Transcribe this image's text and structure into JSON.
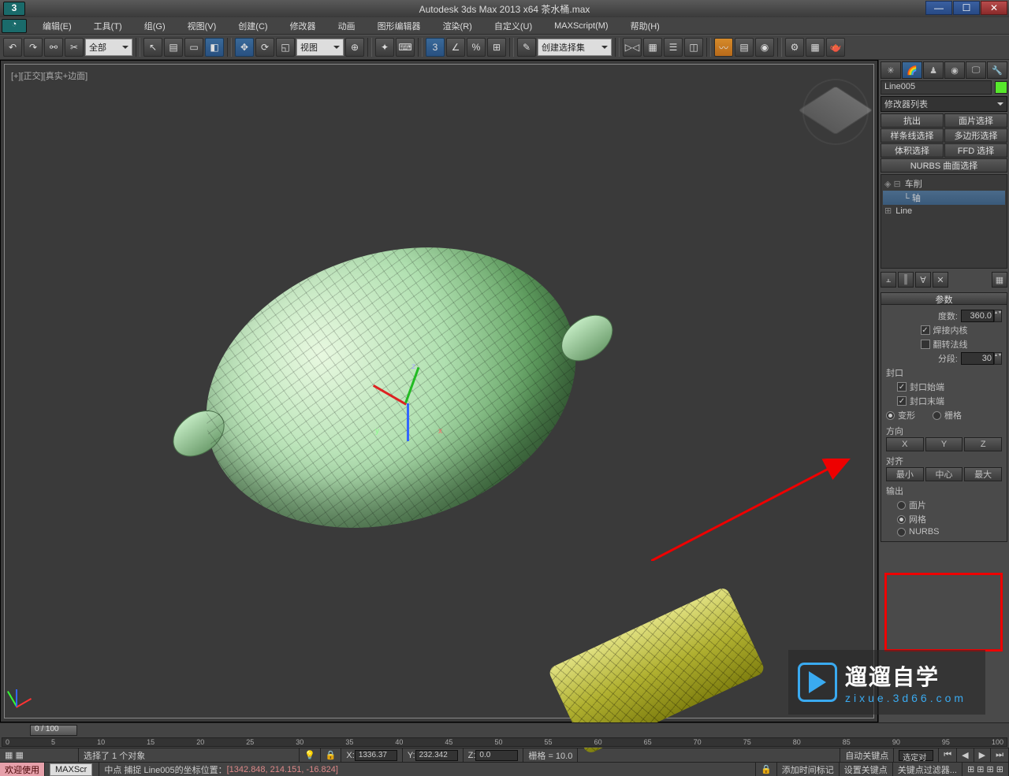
{
  "window": {
    "app_title": "Autodesk 3ds Max  2013 x64     茶水桶.max",
    "min": "—",
    "max": "☐",
    "close": "✕"
  },
  "menubar": {
    "items": [
      "编辑(E)",
      "工具(T)",
      "组(G)",
      "视图(V)",
      "创建(C)",
      "修改器",
      "动画",
      "图形编辑器",
      "渲染(R)",
      "自定义(U)",
      "MAXScript(M)",
      "帮助(H)"
    ]
  },
  "toolbar": {
    "filter_dropdown": "全部",
    "view_dropdown": "视图",
    "nameset_dropdown": "创建选择集"
  },
  "viewport": {
    "label_full": "[+][正交][真实+边面]"
  },
  "commandpanel": {
    "object_name": "Line005",
    "modifier_list": "修改器列表",
    "selectbuttons": [
      "抗出",
      "面片选择",
      "样条线选择",
      "多边形选择",
      "体积选择",
      "FFD 选择"
    ],
    "nurbs_row": "NURBS  曲面选择",
    "stack": {
      "item1": "车削",
      "item1_sub": "轴",
      "item2": "Line"
    },
    "params_title": "参数",
    "degrees_label": "度数:",
    "degrees_value": "360.0",
    "weld_label": "焊接内核",
    "weld_checked": true,
    "flip_label": "翻转法线",
    "flip_checked": false,
    "segments_label": "分段:",
    "segments_value": "30",
    "cap_title": "封口",
    "cap_start": "封口始端",
    "cap_end": "封口末端",
    "morph_label": "变形",
    "grid_label": "栅格",
    "direction_title": "方向",
    "dir_x": "X",
    "dir_y": "Y",
    "dir_z": "Z",
    "align_title": "对齐",
    "align_min": "最小",
    "align_center": "中心",
    "align_max": "最大",
    "output_title": "输出",
    "out_patch": "面片",
    "out_mesh": "网格",
    "out_nurbs": "NURBS"
  },
  "timeline": {
    "frame_label": "0 / 100",
    "ticks": [
      "0",
      "5",
      "10",
      "15",
      "20",
      "25",
      "30",
      "35",
      "40",
      "45",
      "50",
      "55",
      "60",
      "65",
      "70",
      "75",
      "80",
      "85",
      "90",
      "95",
      "100"
    ]
  },
  "status1": {
    "sel_text": "选择了 1 个对象",
    "x_label": "X:",
    "x_val": "1336.37",
    "y_label": "Y:",
    "y_val": "232.342",
    "z_label": "Z:",
    "z_val": "0.0",
    "grid_label": "栅格 = 10.0",
    "autokey": "自动关键点",
    "selset": "选定对"
  },
  "status2": {
    "welcome": "欢迎使用",
    "maxscr": "MAXScr",
    "snap_text": "中点 捕捉 Line005的坐标位置：",
    "coords": "[1342.848, 214.151, -16.824]",
    "addtag": "添加时间标记",
    "setkey": "设置关键点",
    "keyfilter": "关键点过滤器..."
  },
  "watermark": {
    "cn": "遛遛自学",
    "url": "zixue.3d66.com"
  }
}
